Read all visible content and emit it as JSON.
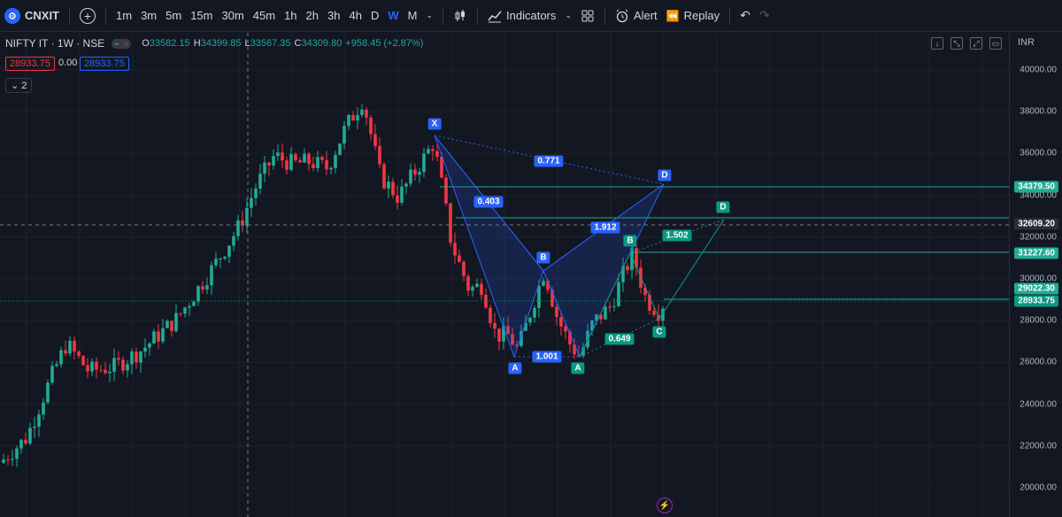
{
  "toolbar": {
    "symbol": "CNXIT",
    "timeframes": [
      "1m",
      "3m",
      "5m",
      "15m",
      "30m",
      "45m",
      "1h",
      "2h",
      "3h",
      "4h",
      "D",
      "W",
      "M"
    ],
    "active_timeframe": "W",
    "indicators_label": "Indicators",
    "alert_label": "Alert",
    "replay_label": "Replay"
  },
  "legend": {
    "symbol_title": "NIFTY IT · 1W · NSE",
    "open_label": "O",
    "open": "33582.15",
    "high_label": "H",
    "high": "34399.85",
    "low_label": "L",
    "low": "33567.35",
    "close_label": "C",
    "close": "34309.80",
    "change": "+958.45 (+2.87%)",
    "sell_price": "28933.75",
    "spread": "0.00",
    "buy_price": "28933.75",
    "indicator_count": "2"
  },
  "axis": {
    "currency": "INR",
    "labels": [
      "40000.00",
      "38000.00",
      "36000.00",
      "34000.00",
      "32000.00",
      "30000.00",
      "28000.00",
      "26000.00",
      "24000.00",
      "22000.00",
      "20000.00"
    ]
  },
  "price_tags": [
    {
      "text": "34379.50",
      "color": "#22ab94"
    },
    {
      "text": "32609.20",
      "color": "#2a2e39"
    },
    {
      "text": "31227.60",
      "color": "#22ab94"
    },
    {
      "text": "29022.30",
      "color": "#22ab94"
    },
    {
      "text": "28933.75",
      "color": "#089981"
    }
  ],
  "pattern_blue": {
    "points": {
      "X": "X",
      "A": "A",
      "B": "B",
      "D": "D"
    },
    "ratios": {
      "xb": "0.403",
      "xd": "0.771",
      "ab": "1.001",
      "bd": "1.912"
    }
  },
  "pattern_green": {
    "points": {
      "A": "A",
      "B": "B",
      "C": "C",
      "D": "D"
    },
    "ratios": {
      "ac": "0.649",
      "bd": "1.502"
    }
  },
  "colors": {
    "up": "#22ab94",
    "down": "#f23645",
    "blue": "#2962ff",
    "green": "#089981"
  }
}
